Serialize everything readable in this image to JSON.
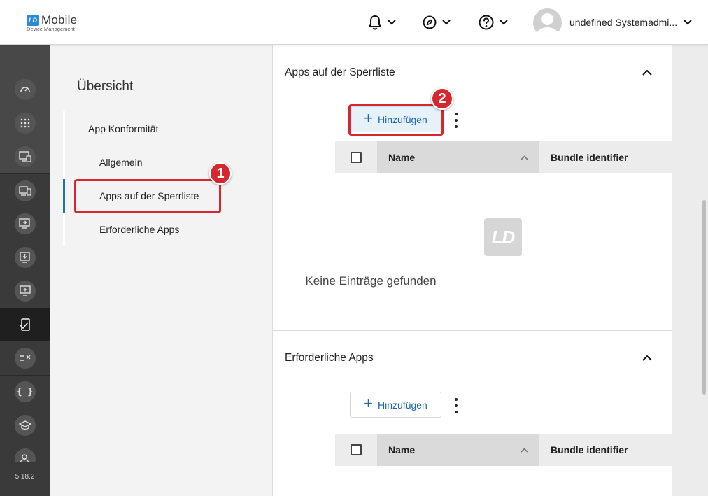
{
  "header": {
    "logo_badge": "LD",
    "logo_main": "Mobile",
    "logo_sub": "Device Management",
    "user_name": "undefined Systemadmi..."
  },
  "rail": {
    "version": "5.18.2",
    "icons": [
      "dashboard-icon",
      "apps-grid-icon",
      "device-settings-icon",
      "devices-icon",
      "device-transfer-icon",
      "download-icon",
      "monitor-add-icon",
      "app-compliance-icon",
      "rules-icon",
      "code-icon",
      "education-icon",
      "users-icon"
    ]
  },
  "nav": {
    "title": "Übersicht",
    "group": "App Konformität",
    "items": [
      "Allgemein",
      "Apps auf der Sperrliste",
      "Erforderliche Apps"
    ]
  },
  "annotations": {
    "badge1": "1",
    "badge2": "2"
  },
  "blacklist": {
    "title": "Apps auf der Sperrliste",
    "add_label": "Hinzufügen",
    "col_name": "Name",
    "col_bundle": "Bundle identifier",
    "empty_logo": "LD",
    "empty_text": "Keine Einträge gefunden"
  },
  "required": {
    "title": "Erforderliche Apps",
    "add_label": "Hinzufügen",
    "col_name": "Name",
    "col_bundle": "Bundle identifier"
  },
  "colors": {
    "accent": "#1b72b8",
    "highlight": "#d8262e",
    "rail": "#3a3a3a"
  }
}
